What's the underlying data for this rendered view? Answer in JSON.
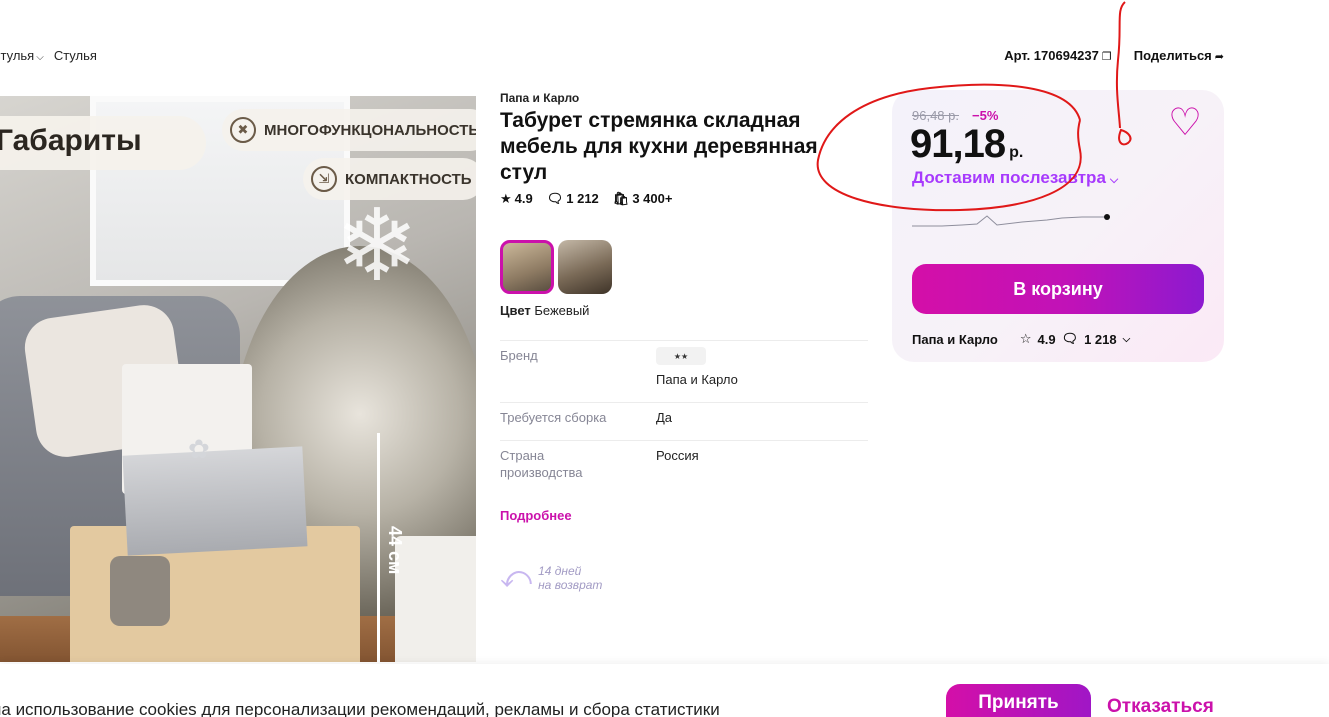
{
  "breadcrumb": {
    "item1": "стулья",
    "item2": "Стулья"
  },
  "topbar": {
    "article": "Арт. 170694237",
    "share": "Поделиться"
  },
  "hero": {
    "headline": "Габариты",
    "badge1": "МНОГОФУНКЦОНАЛЬНОСТЬ",
    "badge2": "КОМПАКТНОСТЬ",
    "dimension": "44 см"
  },
  "product": {
    "brand": "Папа и Карло",
    "title": "Табурет стремянка складная мебель для кухни деревянная стул",
    "rating": "4.9",
    "reviews": "1 212",
    "purchases": "3 400+",
    "color_label": "Цвет",
    "color_value": "Бежевый",
    "specs": [
      {
        "key": "Бренд",
        "value": "Папа и Карло"
      },
      {
        "key": "Требуется сборка",
        "value": "Да"
      },
      {
        "key": "Страна производства",
        "value": "Россия"
      }
    ],
    "more_link": "Подробнее",
    "return_line1": "14 дней",
    "return_line2": "на возврат"
  },
  "price_card": {
    "old_price": "96,48 р.",
    "discount": "−5%",
    "price": "91,18",
    "currency": "р.",
    "delivery": "Доставим послезавтра",
    "add_to_cart": "В корзину",
    "seller": "Папа и Карло",
    "seller_rating": "4.9",
    "seller_reviews": "1 218"
  },
  "cookie": {
    "text": "на использование cookies для персонализации рекомендаций, рекламы и сбора статистики",
    "accept": "Принять",
    "decline": "Отказаться"
  },
  "colors": {
    "accent": "#cb11ab",
    "delivery": "#a73afd",
    "annotation": "#e01818"
  },
  "icons": [
    "chevron-down-icon",
    "copy-icon",
    "share-icon",
    "star-icon",
    "comment-icon",
    "bag-icon",
    "heart-icon",
    "return-icon"
  ]
}
